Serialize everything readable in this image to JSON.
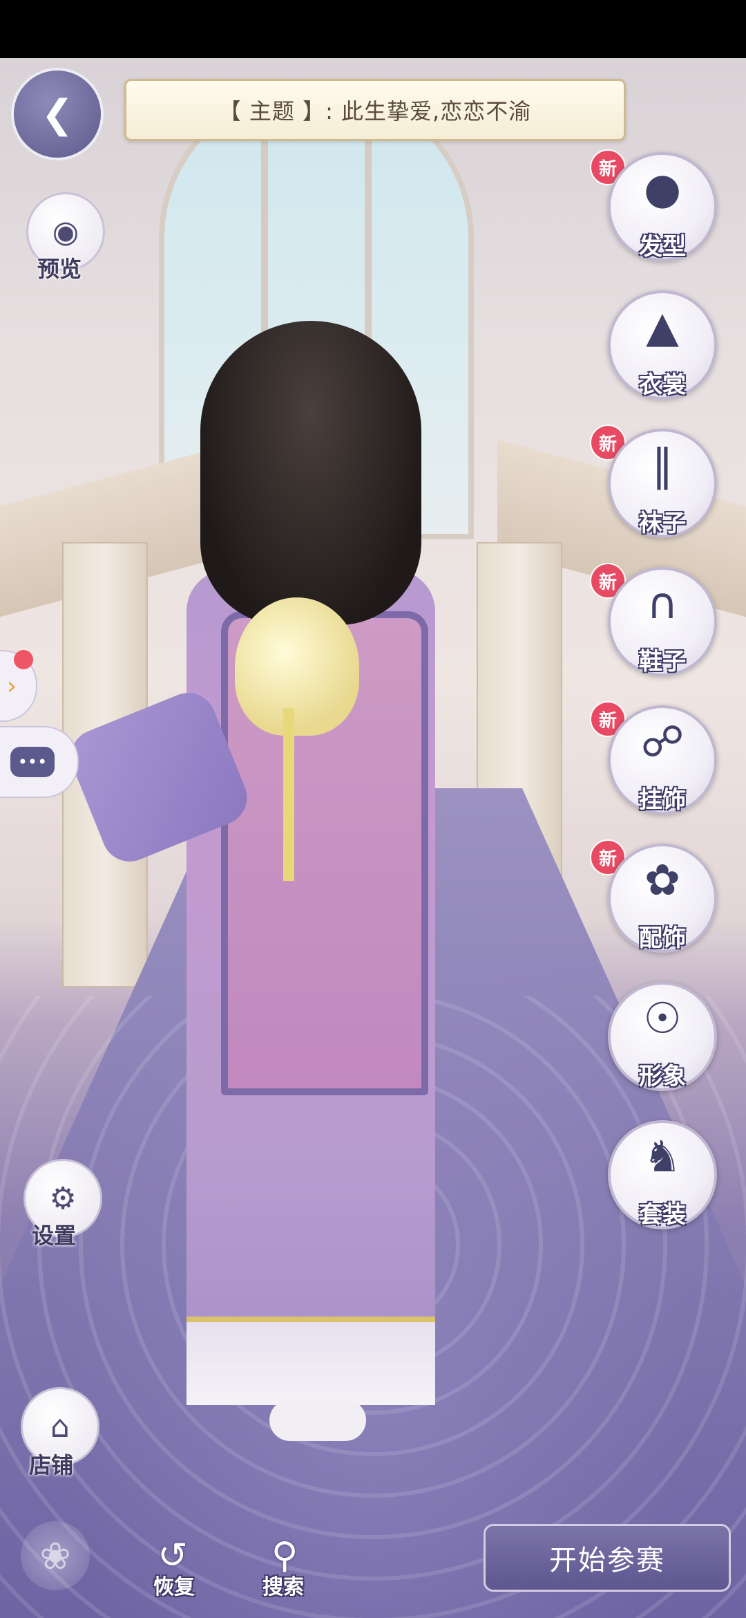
{
  "theme_banner": {
    "text": "【 主题 】:  此生挚爱,恋恋不渝"
  },
  "left_panel": {
    "preview_label": "预览",
    "settings_label": "设置",
    "shop_label": "店铺"
  },
  "categories": [
    {
      "label": "发型",
      "is_new": true,
      "new_text": "新",
      "icon": "hair-icon"
    },
    {
      "label": "衣裳",
      "is_new": false,
      "new_text": "",
      "icon": "clothes-icon"
    },
    {
      "label": "袜子",
      "is_new": true,
      "new_text": "新",
      "icon": "socks-icon"
    },
    {
      "label": "鞋子",
      "is_new": true,
      "new_text": "新",
      "icon": "shoes-icon"
    },
    {
      "label": "挂饰",
      "is_new": true,
      "new_text": "新",
      "icon": "hanging-ornament-icon"
    },
    {
      "label": "配饰",
      "is_new": true,
      "new_text": "新",
      "icon": "accessory-icon"
    },
    {
      "label": "形象",
      "is_new": false,
      "new_text": "",
      "icon": "appearance-icon"
    },
    {
      "label": "套装",
      "is_new": false,
      "new_text": "",
      "icon": "outfit-set-icon"
    }
  ],
  "bottom_bar": {
    "restore_label": "恢复",
    "search_label": "搜索",
    "start_label": "开始参赛"
  },
  "colors": {
    "accent": "#5e5790",
    "new_badge": "#e84a63",
    "banner_bg": "#fffbee"
  }
}
